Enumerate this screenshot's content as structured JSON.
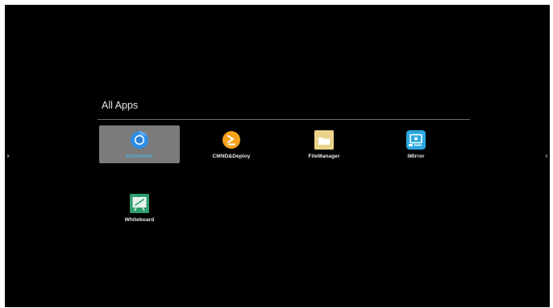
{
  "section": {
    "title": "All Apps"
  },
  "nav": {
    "left_arrow": "›",
    "right_arrow": "‹"
  },
  "apps": [
    {
      "label": "Chromium",
      "icon": "chromium-icon",
      "selected": true
    },
    {
      "label": "CMND&Deploy",
      "icon": "cmnd-deploy-icon",
      "selected": false
    },
    {
      "label": "FileManager",
      "icon": "folder-icon",
      "selected": false
    },
    {
      "label": "iMirror",
      "icon": "screen-mirror-icon",
      "selected": false
    },
    {
      "label": "Whiteboard",
      "icon": "whiteboard-icon",
      "selected": false
    }
  ],
  "colors": {
    "background": "#000000",
    "selected_tile": "#7b7b7b",
    "selected_label": "#47b7e8",
    "chromium_blue": "#2f8ee6",
    "cmnd_orange": "#f7a21b",
    "folder_yellow": "#ead38a",
    "imirror_blue": "#29a8e0",
    "whiteboard_green": "#2e9e6e"
  }
}
